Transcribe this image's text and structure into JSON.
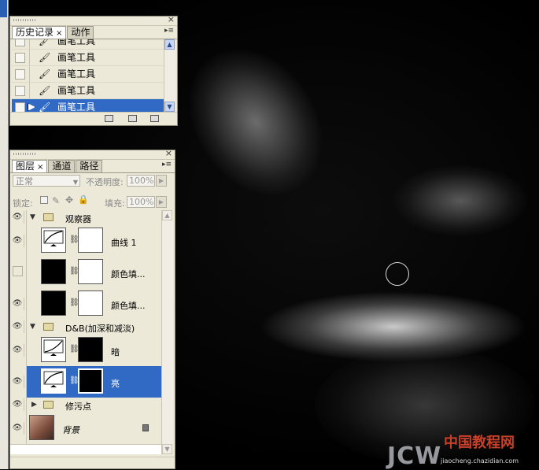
{
  "history_panel": {
    "tabs": [
      {
        "label": "历史记录",
        "active": true
      },
      {
        "label": "动作",
        "active": false
      }
    ],
    "items": [
      {
        "label": "画笔工具",
        "icon": "brush-icon",
        "selected": false
      },
      {
        "label": "画笔工具",
        "icon": "brush-icon",
        "selected": false
      },
      {
        "label": "画笔工具",
        "icon": "brush-icon",
        "selected": false
      },
      {
        "label": "画笔工具",
        "icon": "brush-icon",
        "selected": false
      },
      {
        "label": "画笔工具",
        "icon": "brush-icon",
        "selected": true
      }
    ]
  },
  "layers_panel": {
    "tabs": [
      {
        "label": "图层",
        "active": true
      },
      {
        "label": "通道",
        "active": false
      },
      {
        "label": "路径",
        "active": false
      }
    ],
    "blend_mode": "正常",
    "opacity_label": "不透明度:",
    "opacity_value": "100%",
    "lock_label": "锁定:",
    "fill_label": "填充:",
    "fill_value": "100%",
    "layers": [
      {
        "name": "观察器",
        "kind": "group",
        "expanded": true,
        "visible": true
      },
      {
        "name": "曲线 1",
        "kind": "adjustment",
        "thumb": "curves",
        "mask": "white",
        "visible": true
      },
      {
        "name": "颜色填...",
        "kind": "fill",
        "thumb": "black",
        "mask": "white",
        "visible": false
      },
      {
        "name": "颜色填...",
        "kind": "fill",
        "thumb": "black",
        "mask": "white",
        "visible": true
      },
      {
        "name": "D&B(加深和减淡)",
        "kind": "group",
        "expanded": true,
        "visible": true
      },
      {
        "name": "暗",
        "kind": "adjustment",
        "thumb": "curves",
        "mask": "black",
        "visible": true
      },
      {
        "name": "亮",
        "kind": "adjustment",
        "thumb": "curves",
        "mask": "black",
        "visible": true,
        "selected": true
      },
      {
        "name": "修污点",
        "kind": "group",
        "expanded": false,
        "visible": true
      },
      {
        "name": "背景",
        "kind": "background",
        "thumb": "photo",
        "visible": true,
        "locked": true
      }
    ]
  },
  "watermark": {
    "main": "JCW",
    "cn": "中国教程网",
    "sub": "jiaocheng.chazidian.com"
  },
  "colors": {
    "selection": "#316ac5",
    "panel_bg": "#ece9d8"
  }
}
